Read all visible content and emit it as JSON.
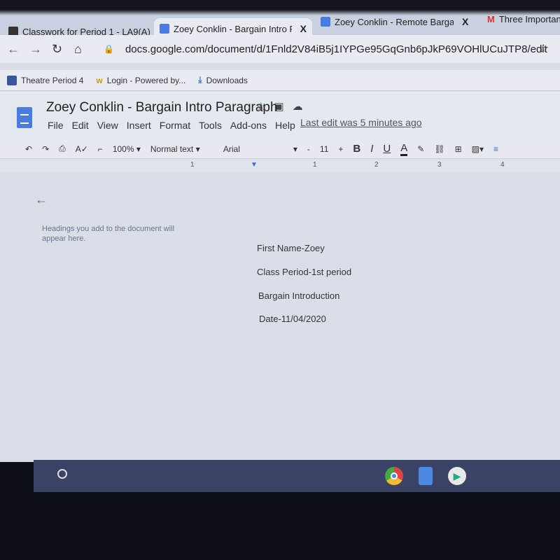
{
  "browser": {
    "tabs": [
      {
        "title": "Classwork for Period 1 - LA9(A)",
        "active": false
      },
      {
        "title": "Zoey Conklin - Bargain Intro Par",
        "active": true
      },
      {
        "title": "Zoey Conklin - Remote Bargain C",
        "active": false
      },
      {
        "title": "Three Importan",
        "active": false
      }
    ],
    "close_glyph": "X",
    "url": "docs.google.com/document/d/1Fnld2V84iB5j1IYPGe95GqGnb6pJkP69VOHlUCuJTP8/edit",
    "bookmarks": [
      {
        "label": "Theatre Period 4"
      },
      {
        "label": "Login - Powered by..."
      },
      {
        "label": "Downloads"
      }
    ]
  },
  "docs": {
    "title": "Zoey Conklin - Bargain Intro Paragraph",
    "menu": [
      "File",
      "Edit",
      "View",
      "Insert",
      "Format",
      "Tools",
      "Add-ons",
      "Help"
    ],
    "last_edit": "Last edit was 5 minutes ago",
    "toolbar": {
      "zoom": "100%",
      "style": "Normal text",
      "font": "Arial",
      "size": "11",
      "minus": "-",
      "plus": "+",
      "bold": "B",
      "italic": "I",
      "underline": "U",
      "text_color": "A"
    },
    "ruler": [
      "1",
      "1",
      "2",
      "3",
      "4"
    ],
    "outline_hint": "Headings you add to the document will appear here.",
    "body_lines": [
      "First Name-Zoey",
      "Class Period-1st period",
      "Bargain Introduction",
      "Date-11/04/2020"
    ]
  },
  "colors": {
    "docs_blue": "#4a7be0",
    "shelf": "#3a4266"
  }
}
